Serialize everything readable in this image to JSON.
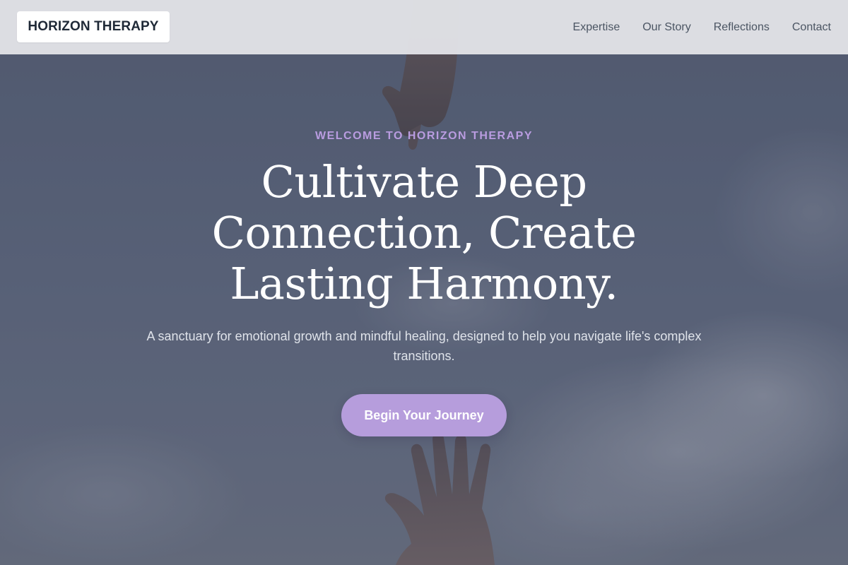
{
  "header": {
    "logo_text": "HORIZON THERAPY",
    "nav": [
      {
        "label": "Expertise"
      },
      {
        "label": "Our Story"
      },
      {
        "label": "Reflections"
      },
      {
        "label": "Contact"
      }
    ]
  },
  "hero": {
    "eyebrow": "WELCOME TO HORIZON THERAPY",
    "headline": "Cultivate Deep Connection, Create Lasting Harmony.",
    "subtext": "A sanctuary for emotional growth and mindful healing, designed to help you navigate life's complex transitions.",
    "cta_label": "Begin Your Journey",
    "background_image": "reaching-hands-in-sky"
  },
  "colors": {
    "accent": "#b69ddc",
    "eyebrow": "#b99ce0",
    "header_bg": "#e4e6ea",
    "text_dark": "#1f2937",
    "nav_text": "#4b5563"
  }
}
